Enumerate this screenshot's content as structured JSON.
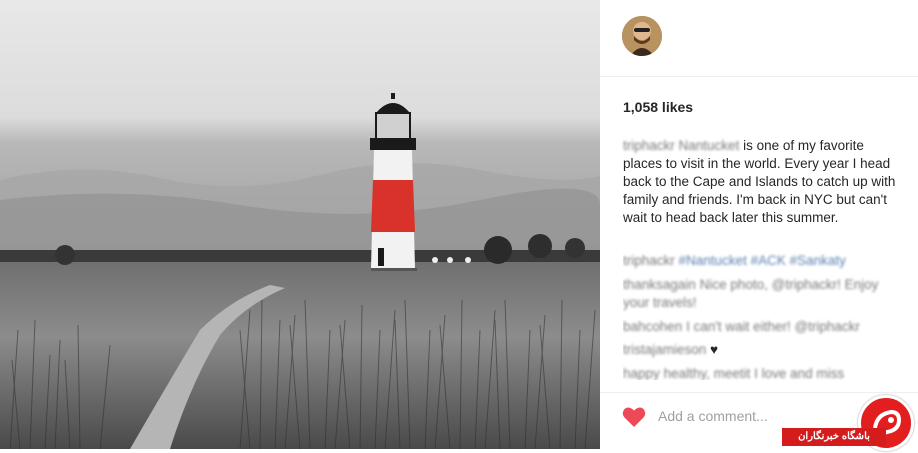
{
  "post": {
    "likes": "1,058 likes",
    "caption": {
      "username": "triphackr",
      "location_tag": "Nantucket",
      "text": " is one of my favorite places to visit in the world. Every year I head back to the Cape and Islands to catch up with family and friends. I'm back in NYC but can't wait to head back later this summer."
    },
    "comments": [
      {
        "user": "triphackr",
        "text": "#Nantucket #ACK #Sankaty"
      },
      {
        "user": "thanksagain",
        "text": "Nice photo, @triphackr! Enjoy your travels!"
      },
      {
        "user": "bahcohen",
        "text": "I can't wait either! @triphackr"
      },
      {
        "user": "tristajamieson",
        "text": "♥"
      },
      {
        "user": "happy",
        "text": "healthy, meetit I love and miss"
      }
    ],
    "add_comment_placeholder": "Add a comment...",
    "heart_icon": "heart-icon",
    "accent": "#ed4956"
  },
  "watermark": {
    "text": "باشگاه خبرنگاران",
    "color": "#d41c1c"
  }
}
